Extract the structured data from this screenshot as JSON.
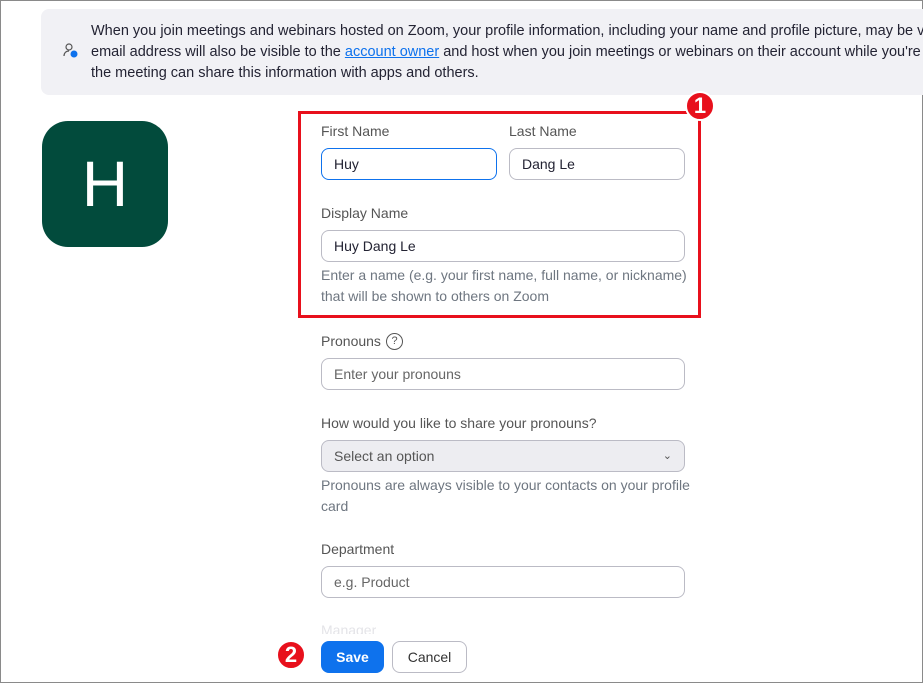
{
  "banner": {
    "text_before": "When you join meetings and webinars hosted on Zoom, your profile information, including your name and profile picture, may be visible",
    "line2_before": "email address will also be visible to the ",
    "link": "account owner",
    "line2_after": " and host when you join meetings or webinars on their account while you're signed",
    "line3": "the meeting can share this information with apps and others."
  },
  "avatar": {
    "initial": "H",
    "color": "#024b3c"
  },
  "form": {
    "first_name_label": "First Name",
    "first_name_value": "Huy",
    "last_name_label": "Last Name",
    "last_name_value": "Dang Le",
    "display_name_label": "Display Name",
    "display_name_value": "Huy Dang Le",
    "display_name_help": "Enter a name (e.g. your first name, full name, or nickname)",
    "display_name_help2": "that will be shown to others on Zoom",
    "pronouns_label": "Pronouns",
    "pronouns_placeholder": "Enter your pronouns",
    "share_label": "How would you like to share your pronouns?",
    "share_value": "Select an option",
    "share_help": "Pronouns are always visible to your contacts on your profile",
    "share_help2": "card",
    "department_label": "Department",
    "department_placeholder": "e.g. Product",
    "manager_label": "Manager"
  },
  "buttons": {
    "save": "Save",
    "cancel": "Cancel"
  },
  "annotations": {
    "one": "1",
    "two": "2"
  }
}
